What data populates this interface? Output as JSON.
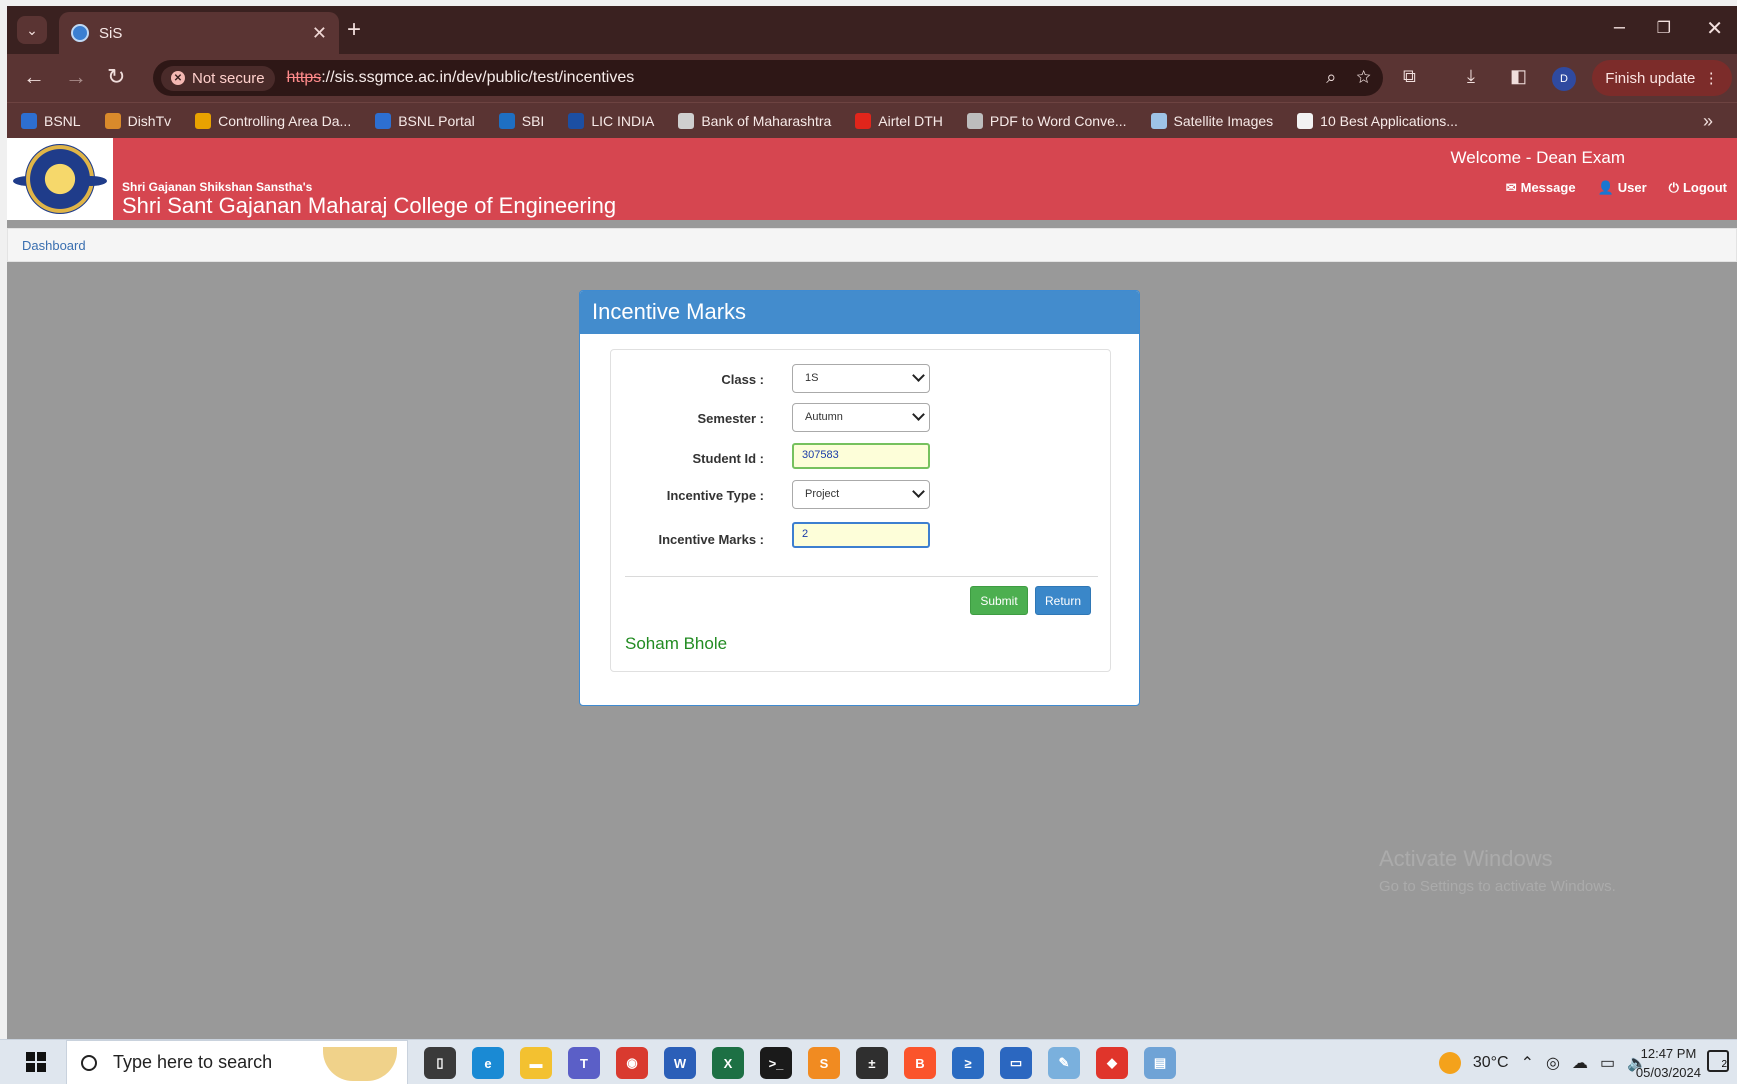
{
  "browser": {
    "tab_title": "SiS",
    "security_label": "Not secure",
    "url_scheme": "https",
    "url_rest": "://sis.ssgmce.ac.in/dev/public/test/incentives",
    "profile_initial": "D",
    "finish_update_label": "Finish update",
    "bookmarks": [
      {
        "label": "BSNL",
        "icon": "bsnl-icon",
        "color": "#2d6fd1"
      },
      {
        "label": "DishTv",
        "icon": "dishtv-icon",
        "color": "#d98a2b"
      },
      {
        "label": "Controlling Area Da...",
        "icon": "scn-icon",
        "color": "#e8a200"
      },
      {
        "label": "BSNL Portal",
        "icon": "bsnl-icon",
        "color": "#2d6fd1"
      },
      {
        "label": "SBI",
        "icon": "sbi-icon",
        "color": "#1e6fc2"
      },
      {
        "label": "LIC INDIA",
        "icon": "lic-icon",
        "color": "#1c4fa3"
      },
      {
        "label": "Bank of Maharashtra",
        "icon": "globe-icon",
        "color": "#cfcfcf"
      },
      {
        "label": "Airtel DTH",
        "icon": "airtel-icon",
        "color": "#e1251b"
      },
      {
        "label": "PDF to Word Conve...",
        "icon": "pdf-icon",
        "color": "#bdbdbd"
      },
      {
        "label": "Satellite Images",
        "icon": "satellite-icon",
        "color": "#9ec3e6"
      },
      {
        "label": "10 Best Applications...",
        "icon": "app-icon",
        "color": "#f2f2f2"
      }
    ]
  },
  "header": {
    "subtitle": "Shri Gajanan Shikshan Sanstha's",
    "college_name": "Shri Sant Gajanan Maharaj College of Engineering",
    "welcome": "Welcome - Dean Exam",
    "links": {
      "message": "Message",
      "user": "User",
      "logout": "Logout"
    }
  },
  "breadcrumb": {
    "dashboard": "Dashboard"
  },
  "form": {
    "title": "Incentive Marks",
    "class_label": "Class :",
    "class_value": "1S",
    "semester_label": "Semester :",
    "semester_value": "Autumn",
    "student_id_label": "Student Id :",
    "student_id_value": "307583",
    "incentive_type_label": "Incentive Type :",
    "incentive_type_value": "Project",
    "incentive_marks_label": "Incentive Marks :",
    "incentive_marks_value": "2",
    "submit_label": "Submit",
    "return_label": "Return",
    "student_name": "Soham Bhole"
  },
  "watermark": {
    "line1": "Activate Windows",
    "line2": "Go to Settings to activate Windows."
  },
  "taskbar": {
    "search_placeholder": "Type here to search",
    "temperature": "30°C",
    "time": "12:47 PM",
    "date": "05/03/2024",
    "notification_count": "2",
    "apps": [
      {
        "name": "task-view-icon",
        "color": "#3a3a3a",
        "glyph": "▯"
      },
      {
        "name": "edge-icon",
        "color": "#1a8ad4",
        "glyph": "e"
      },
      {
        "name": "file-explorer-icon",
        "color": "#f3c130",
        "glyph": "▬"
      },
      {
        "name": "teams-icon",
        "color": "#5b5fc7",
        "glyph": "T"
      },
      {
        "name": "chrome-icon",
        "color": "#d93a2f",
        "glyph": "◉"
      },
      {
        "name": "word-icon",
        "color": "#2b5fb8",
        "glyph": "W"
      },
      {
        "name": "excel-icon",
        "color": "#1d7044",
        "glyph": "X"
      },
      {
        "name": "terminal-icon",
        "color": "#1a1a1a",
        "glyph": ">_"
      },
      {
        "name": "sublime-icon",
        "color": "#f18b21",
        "glyph": "S"
      },
      {
        "name": "git-icon",
        "color": "#2f2f2f",
        "glyph": "±"
      },
      {
        "name": "brave-icon",
        "color": "#fb542b",
        "glyph": "B"
      },
      {
        "name": "powershell-icon",
        "color": "#2a6bc2",
        "glyph": "≥"
      },
      {
        "name": "sticky-notes-icon",
        "color": "#2b67c0",
        "glyph": "▭"
      },
      {
        "name": "paint-icon",
        "color": "#7ab0dd",
        "glyph": "✎"
      },
      {
        "name": "anydesk-icon",
        "color": "#e0352b",
        "glyph": "◆"
      },
      {
        "name": "notepad-icon",
        "color": "#6fa3d6",
        "glyph": "▤"
      }
    ]
  }
}
